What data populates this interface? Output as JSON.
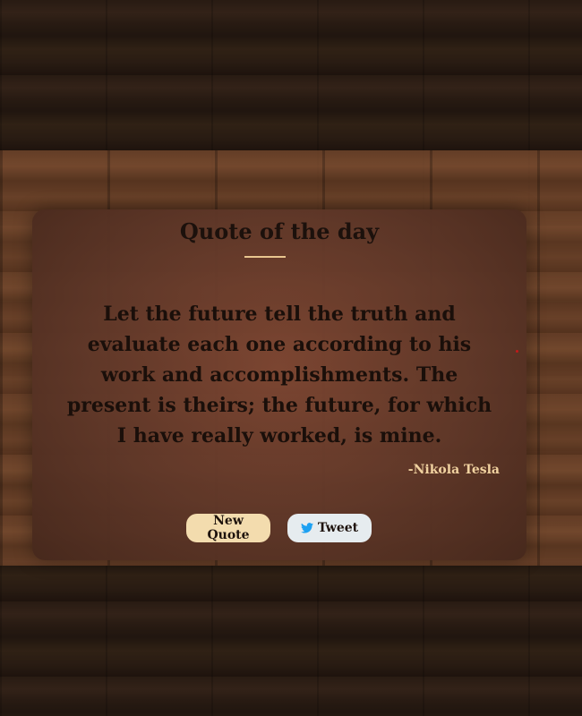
{
  "card": {
    "title": "Quote of the day",
    "quote": "Let the future tell the truth and evaluate each one according to his work and accomplishments. The present is theirs; the future, for which I have really worked, is mine.",
    "author": "-Nikola Tesla"
  },
  "buttons": {
    "new_quote_label": "New Quote",
    "tweet_label": "Tweet"
  },
  "colors": {
    "accent": "#e9c68f",
    "new_quote_bg": "#f3dcae",
    "tweet_bg": "#e6ecef",
    "twitter_blue": "#1da1f2",
    "author_text": "#f1d2a0"
  },
  "icons": {
    "tweet_icon": "twitter-bird-icon"
  }
}
